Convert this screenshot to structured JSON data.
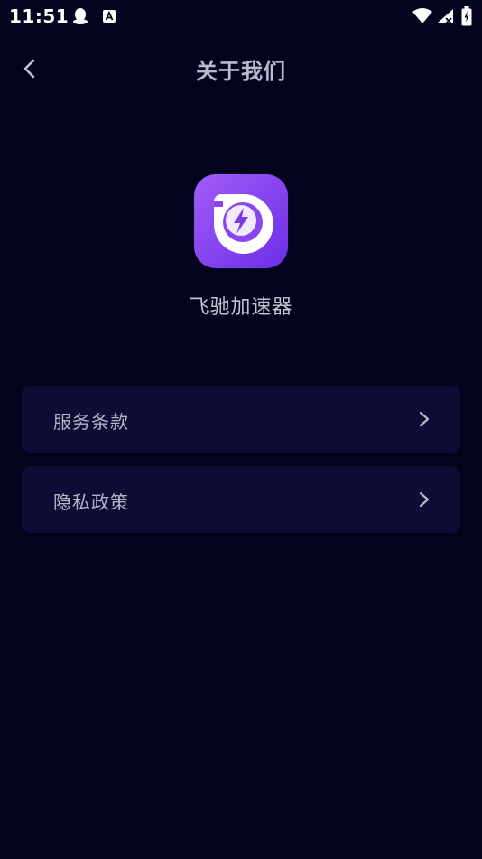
{
  "status_bar": {
    "time": "11:51",
    "icons": [
      "qq-icon",
      "a-icon",
      "wifi-icon",
      "signal-icon",
      "battery-icon"
    ]
  },
  "header": {
    "title": "关于我们",
    "back_icon": "chevron-left-icon"
  },
  "app": {
    "name": "飞驰加速器",
    "logo_icon": "lightning-app-logo",
    "logo_gradient": [
      "#a35cf7",
      "#6a2ee6"
    ]
  },
  "menu": {
    "items": [
      {
        "label": "服务条款",
        "icon": "chevron-right-icon"
      },
      {
        "label": "隐私政策",
        "icon": "chevron-right-icon"
      }
    ]
  },
  "colors": {
    "background": "#03031d",
    "card": "#0e0c34",
    "text": "#b5b5c7"
  }
}
